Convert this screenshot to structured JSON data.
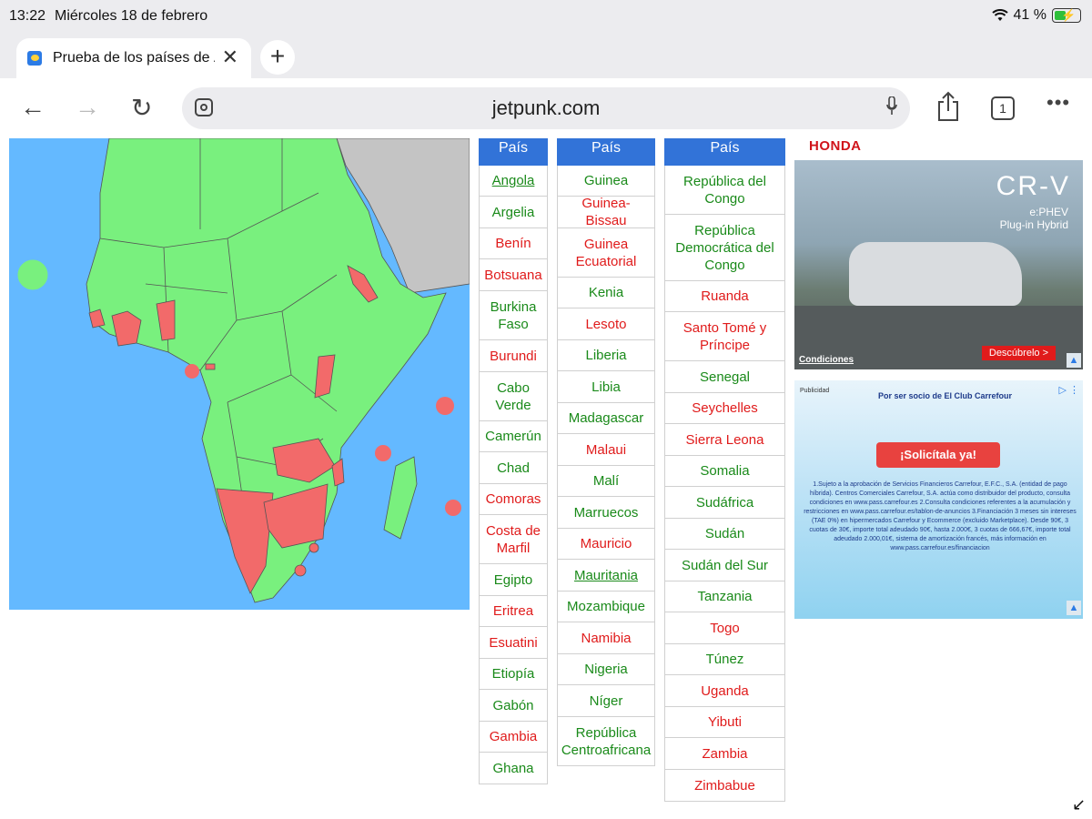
{
  "status": {
    "time": "13:22",
    "date": "Miércoles 18 de febrero",
    "battery": "41 %"
  },
  "tab": {
    "title": "Prueba de los países de África"
  },
  "toolbar": {
    "url": "jetpunk.com",
    "tab_count": "1"
  },
  "table": {
    "header": "País",
    "colors": {
      "correct": "#1a8a1a",
      "missed": "#e01b1b",
      "header_bg": "#3273d8"
    },
    "columns": [
      [
        {
          "name": "Angola",
          "status": "correct"
        },
        {
          "name": "Argelia",
          "status": "correct"
        },
        {
          "name": "Benín",
          "status": "missed"
        },
        {
          "name": "Botsuana",
          "status": "missed"
        },
        {
          "name": "Burkina Faso",
          "status": "correct"
        },
        {
          "name": "Burundi",
          "status": "missed"
        },
        {
          "name": "Cabo Verde",
          "status": "correct"
        },
        {
          "name": "Camerún",
          "status": "correct"
        },
        {
          "name": "Chad",
          "status": "correct"
        },
        {
          "name": "Comoras",
          "status": "missed"
        },
        {
          "name": "Costa de Marfil",
          "status": "missed"
        },
        {
          "name": "Egipto",
          "status": "correct"
        },
        {
          "name": "Eritrea",
          "status": "missed"
        },
        {
          "name": "Esuatini",
          "status": "missed"
        },
        {
          "name": "Etiopía",
          "status": "correct"
        },
        {
          "name": "Gabón",
          "status": "correct"
        },
        {
          "name": "Gambia",
          "status": "missed"
        },
        {
          "name": "Ghana",
          "status": "correct"
        }
      ],
      [
        {
          "name": "Guinea",
          "status": "correct"
        },
        {
          "name": "Guinea-Bissau",
          "status": "missed"
        },
        {
          "name": "Guinea Ecuatorial",
          "status": "missed"
        },
        {
          "name": "Kenia",
          "status": "correct"
        },
        {
          "name": "Lesoto",
          "status": "missed"
        },
        {
          "name": "Liberia",
          "status": "correct"
        },
        {
          "name": "Libia",
          "status": "correct"
        },
        {
          "name": "Madagascar",
          "status": "correct"
        },
        {
          "name": "Malaui",
          "status": "missed"
        },
        {
          "name": "Malí",
          "status": "correct"
        },
        {
          "name": "Marruecos",
          "status": "correct"
        },
        {
          "name": "Mauricio",
          "status": "missed"
        },
        {
          "name": "Mauritania",
          "status": "correct"
        },
        {
          "name": "Mozambique",
          "status": "correct"
        },
        {
          "name": "Namibia",
          "status": "missed"
        },
        {
          "name": "Nigeria",
          "status": "correct"
        },
        {
          "name": "Níger",
          "status": "correct"
        },
        {
          "name": "República Centroafricana",
          "status": "correct"
        }
      ],
      [
        {
          "name": "República del Congo",
          "status": "correct"
        },
        {
          "name": "República Democrática del Congo",
          "status": "correct"
        },
        {
          "name": "Ruanda",
          "status": "missed"
        },
        {
          "name": "Santo Tomé y Príncipe",
          "status": "missed"
        },
        {
          "name": "Senegal",
          "status": "correct"
        },
        {
          "name": "Seychelles",
          "status": "missed"
        },
        {
          "name": "Sierra Leona",
          "status": "missed"
        },
        {
          "name": "Somalia",
          "status": "correct"
        },
        {
          "name": "Sudáfrica",
          "status": "correct"
        },
        {
          "name": "Sudán",
          "status": "correct"
        },
        {
          "name": "Sudán del Sur",
          "status": "correct"
        },
        {
          "name": "Tanzania",
          "status": "correct"
        },
        {
          "name": "Togo",
          "status": "missed"
        },
        {
          "name": "Túnez",
          "status": "correct"
        },
        {
          "name": "Uganda",
          "status": "missed"
        },
        {
          "name": "Yibuti",
          "status": "missed"
        },
        {
          "name": "Zambia",
          "status": "missed"
        },
        {
          "name": "Zimbabue",
          "status": "missed"
        }
      ]
    ]
  },
  "ad1": {
    "brand": "HONDA",
    "model": "CR-V",
    "line1": "e:PHEV",
    "line2": "Plug-in Hybrid",
    "cta": "Descúbrelo >",
    "conditions": "Condiciones"
  },
  "ad2": {
    "label": "Publicidad",
    "headline": "Por ser socio de El Club Carrefour",
    "button": "¡Solicítala ya!",
    "legal": "1.Sujeto a la aprobación de Servicios Financieros Carrefour, E.F.C., S.A. (entidad de pago híbrida). Centros Comerciales Carrefour, S.A. actúa como distribuidor del producto, consulta condiciones en www.pass.carrefour.es 2.Consulta condiciones referentes a la acumulación y restricciones en www.pass.carrefour.es/tablon-de-anuncios 3.Financiación 3 meses sin intereses (TAE 0%) en hipermercados Carrefour y Ecommerce (excluido Marketplace). Desde 90€, 3 cuotas de 30€, importe total adeudado 90€, hasta 2.000€, 3 cuotas de 666,67€, importe total adeudado 2.000,01€, sistema de amortización francés, más información en www.pass.carrefour.es/financiacion"
  },
  "map": {
    "colors": {
      "ocean": "#64b9ff",
      "land_correct": "#79f07e",
      "land_missed": "#f26a6a",
      "other_land": "#c4c4c4"
    }
  }
}
